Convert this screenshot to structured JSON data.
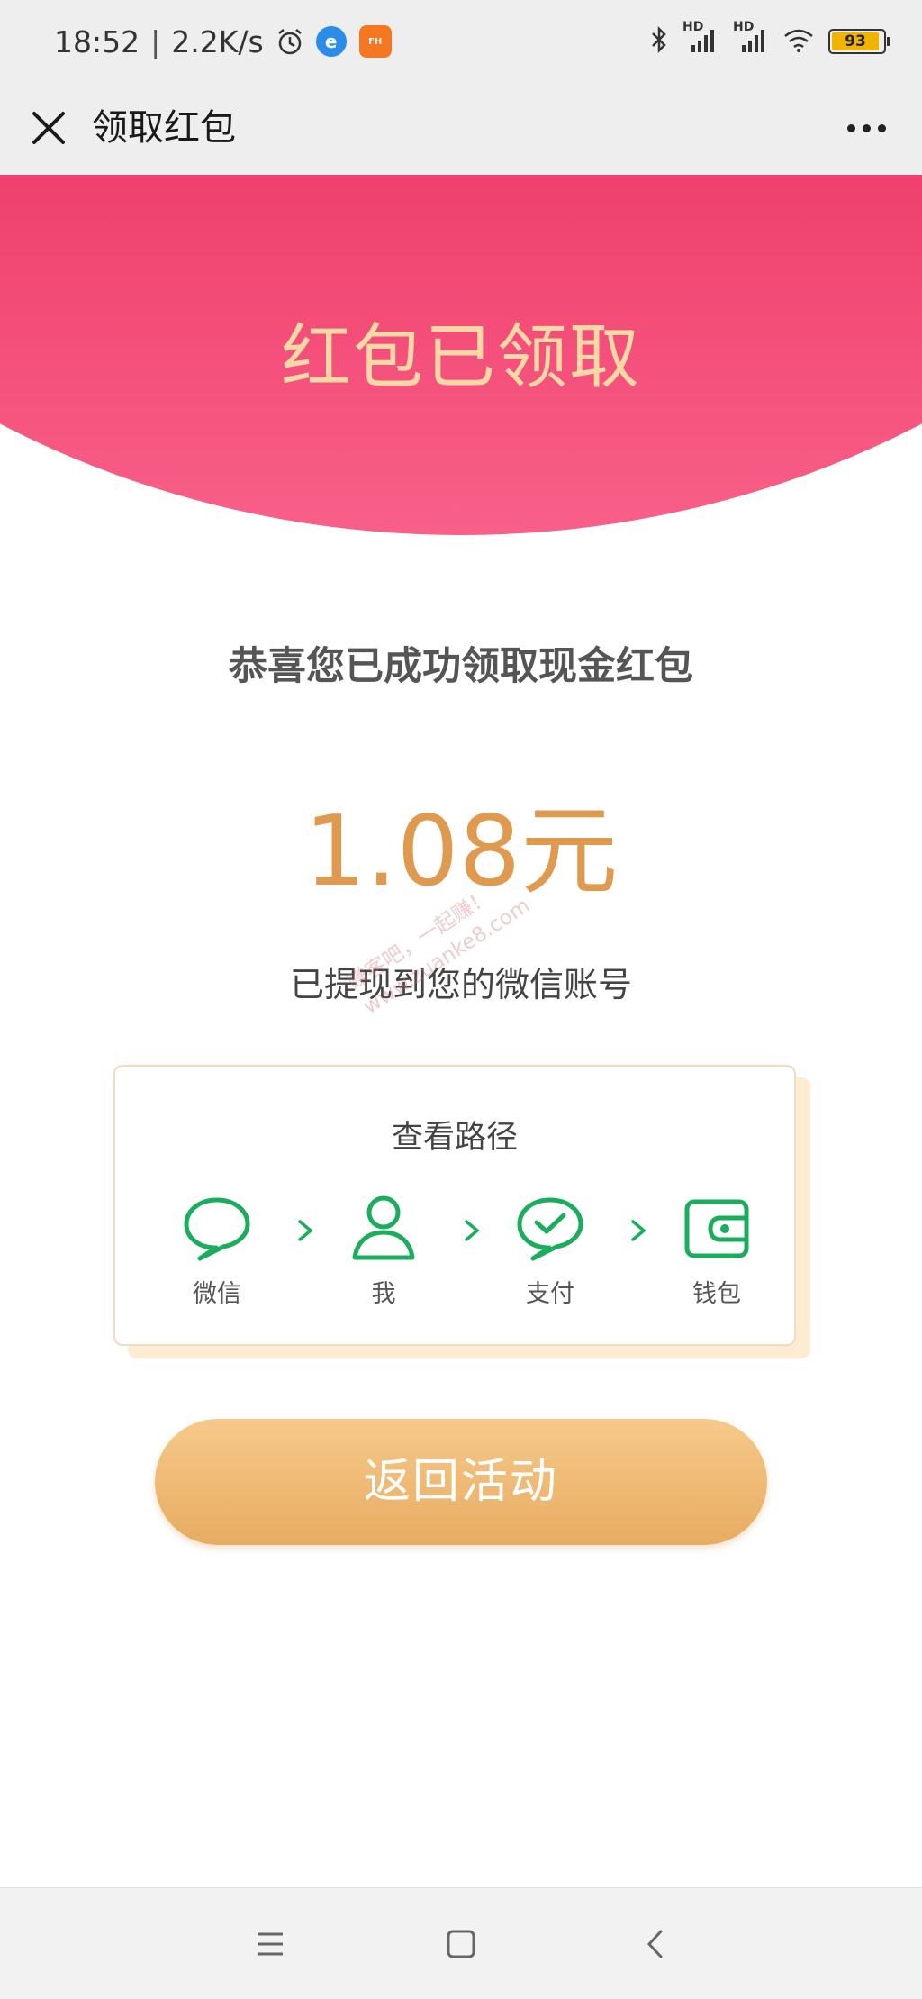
{
  "status_bar": {
    "time": "18:52",
    "separator": "|",
    "net_speed": "2.2K/s",
    "app_badge_1": "e",
    "app_badge_2": "FH",
    "signal_label_1": "HD",
    "signal_label_2": "HD",
    "battery_level": "93",
    "icons": [
      "alarm-clock-icon",
      "bluetooth-icon",
      "signal-icon",
      "wifi-icon",
      "battery-icon"
    ]
  },
  "nav": {
    "title": "领取红包",
    "close_icon": "close-icon",
    "more_icon": "more-icon"
  },
  "header": {
    "title": "红包已领取",
    "colors": {
      "top": "#ef3f6c",
      "bottom": "#f86089",
      "title": "#f8d8a4"
    }
  },
  "main": {
    "congrats": "恭喜您已成功领取现金红包",
    "amount": "1.08元",
    "withdraw_note": "已提现到您的微信账号",
    "accent_color": "#e09a4f"
  },
  "watermark": {
    "line1": "赚客吧，一起赚！",
    "line2": "www.zuanke8.com"
  },
  "path_card": {
    "title": "查看路径",
    "steps": [
      {
        "label": "微信",
        "icon": "chat-bubble-icon"
      },
      {
        "label": "我",
        "icon": "user-icon"
      },
      {
        "label": "支付",
        "icon": "payment-check-icon"
      },
      {
        "label": "钱包",
        "icon": "wallet-icon"
      }
    ],
    "icon_color": "#1aad5c"
  },
  "return_button": {
    "label": "返回活动"
  },
  "bottom_nav": {
    "icons": [
      "menu-icon",
      "home-icon",
      "back-icon"
    ]
  }
}
